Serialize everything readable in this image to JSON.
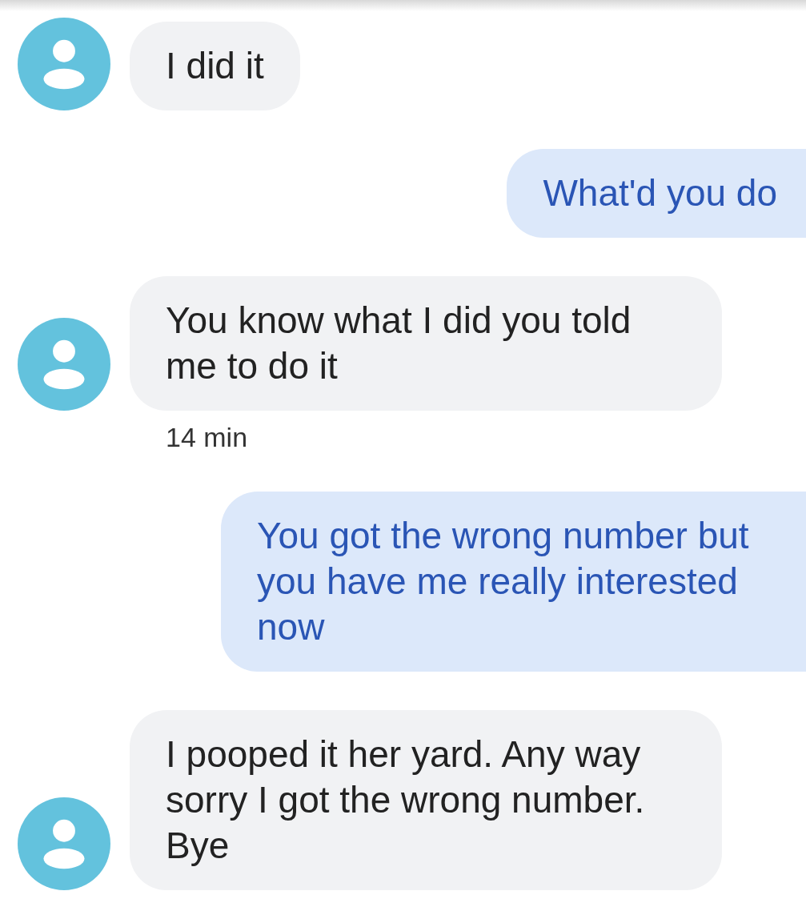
{
  "messages": [
    {
      "kind": "received",
      "text": "I did it"
    },
    {
      "kind": "sent",
      "text": "What'd you do"
    },
    {
      "kind": "received",
      "text": "You know what I did you told me to do it",
      "timestamp": "14 min"
    },
    {
      "kind": "sent",
      "text": "You got the wrong number but you have me really interested now"
    },
    {
      "kind": "received",
      "text": "I pooped it her yard. Any way sorry I got the wrong number. Bye"
    }
  ]
}
